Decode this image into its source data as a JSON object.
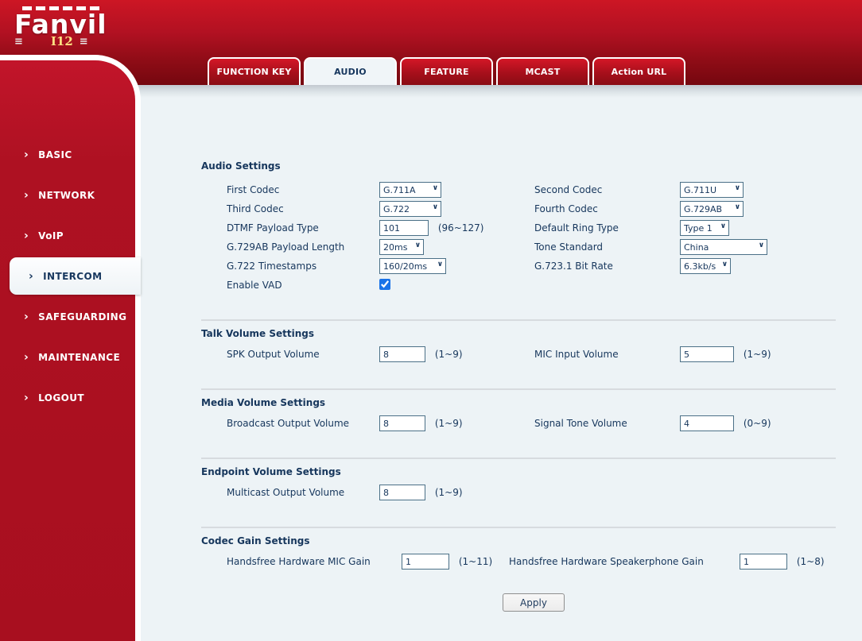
{
  "header": {
    "brand": "Fanvil",
    "model": "I12",
    "menu_bars": "≡"
  },
  "tabs": [
    {
      "label": "FUNCTION KEY"
    },
    {
      "label": "AUDIO"
    },
    {
      "label": "FEATURE"
    },
    {
      "label": "MCAST"
    },
    {
      "label": "Action URL"
    }
  ],
  "sidebar": {
    "arrow": "›",
    "items": [
      {
        "label": "BASIC"
      },
      {
        "label": "NETWORK"
      },
      {
        "label": "VoIP"
      },
      {
        "label": "INTERCOM"
      },
      {
        "label": "SAFEGUARDING"
      },
      {
        "label": "MAINTENANCE"
      },
      {
        "label": "LOGOUT"
      }
    ]
  },
  "audio": {
    "title": "Audio Settings",
    "first_codec": {
      "label": "First Codec",
      "value": "G.711A"
    },
    "second_codec": {
      "label": "Second Codec",
      "value": "G.711U"
    },
    "third_codec": {
      "label": "Third Codec",
      "value": "G.722"
    },
    "fourth_codec": {
      "label": "Fourth Codec",
      "value": "G.729AB"
    },
    "dtmf_payload_type": {
      "label": "DTMF Payload Type",
      "value": "101",
      "hint": "(96~127)"
    },
    "default_ring_type": {
      "label": "Default Ring Type",
      "value": "Type 1"
    },
    "g729ab_payload_length": {
      "label": "G.729AB Payload Length",
      "value": "20ms"
    },
    "tone_standard": {
      "label": "Tone Standard",
      "value": "China"
    },
    "g722_timestamps": {
      "label": "G.722 Timestamps",
      "value": "160/20ms"
    },
    "g7231_bit_rate": {
      "label": "G.723.1 Bit Rate",
      "value": "6.3kb/s"
    },
    "enable_vad": {
      "label": "Enable VAD",
      "checked": true
    }
  },
  "talk": {
    "title": "Talk Volume Settings",
    "spk_output": {
      "label": "SPK Output Volume",
      "value": "8",
      "hint": "(1~9)"
    },
    "mic_input": {
      "label": "MIC Input Volume",
      "value": "5",
      "hint": "(1~9)"
    }
  },
  "media": {
    "title": "Media Volume Settings",
    "broadcast_output": {
      "label": "Broadcast Output Volume",
      "value": "8",
      "hint": "(1~9)"
    },
    "signal_tone": {
      "label": "Signal Tone Volume",
      "value": "4",
      "hint": "(0~9)"
    }
  },
  "endpoint": {
    "title": "Endpoint Volume Settings",
    "multicast_output": {
      "label": "Multicast Output Volume",
      "value": "8",
      "hint": "(1~9)"
    }
  },
  "gain": {
    "title": "Codec Gain Settings",
    "mic_gain": {
      "label": "Handsfree Hardware MIC Gain",
      "value": "1",
      "hint": "(1~11)"
    },
    "spk_gain": {
      "label": "Handsfree Hardware Speakerphone Gain",
      "value": "1",
      "hint": "(1~8)"
    }
  },
  "actions": {
    "apply": "Apply"
  },
  "colors": {
    "sidebar_red": "#ae1122",
    "header_red_top": "#cd1624",
    "header_red_bottom": "#75070f",
    "navy_text": "#16365c",
    "content_bg": "#edf3f6",
    "checkbox_blue": "#1a73e8",
    "field_border": "#4b7087"
  }
}
